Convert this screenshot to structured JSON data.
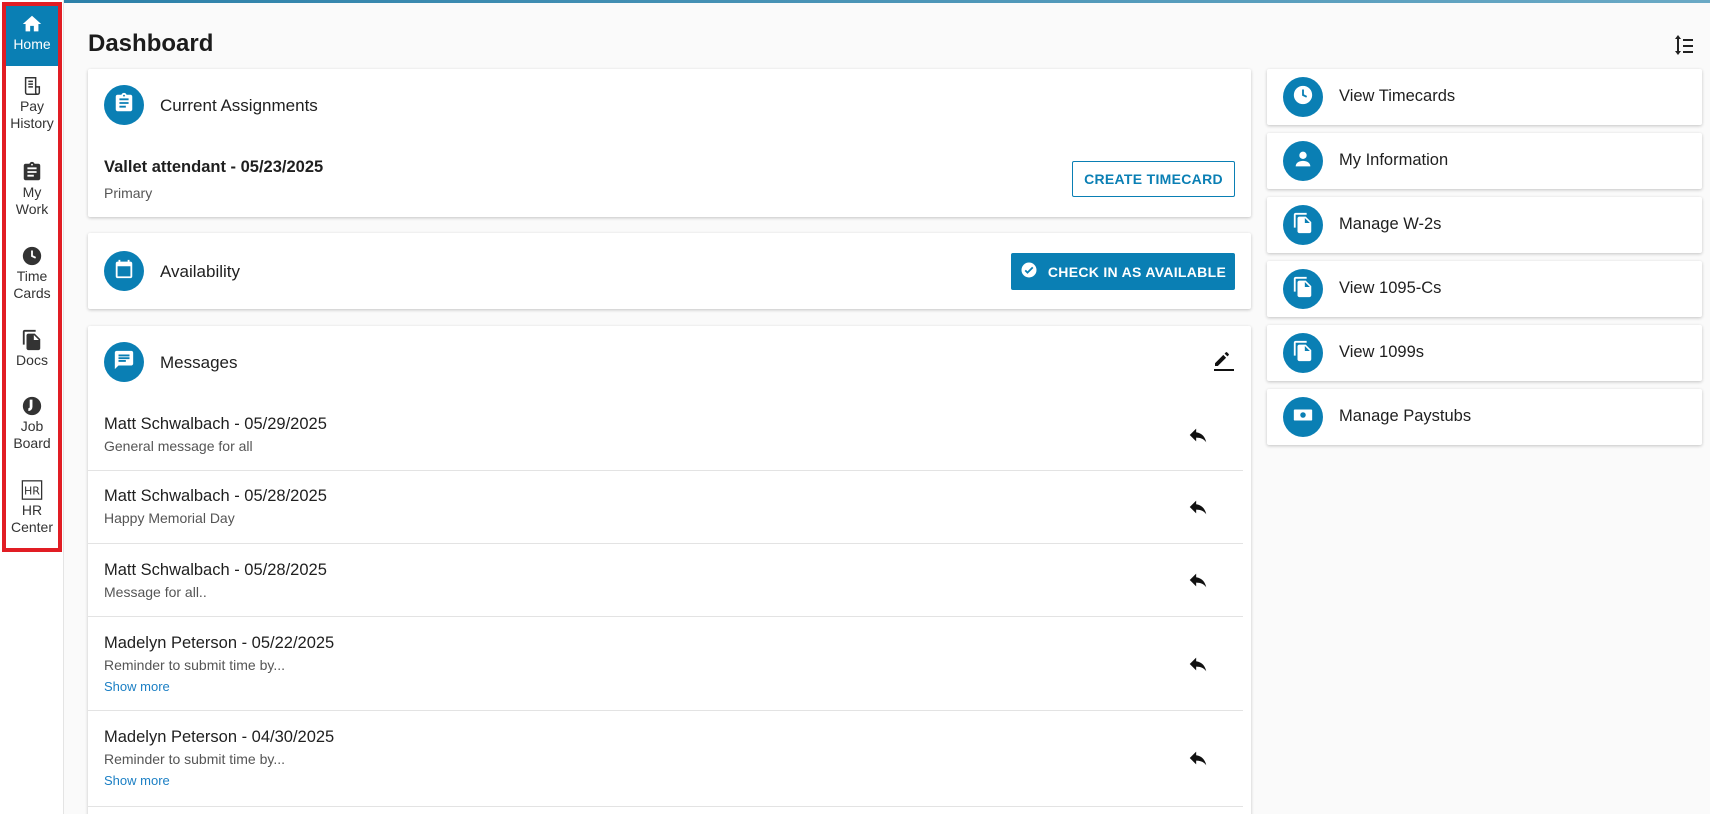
{
  "sidebar": {
    "items": [
      {
        "label_line1": "Home",
        "label_line2": "",
        "icon": "home-icon"
      },
      {
        "label_line1": "Pay",
        "label_line2": "History",
        "icon": "receipt-icon"
      },
      {
        "label_line1": "My",
        "label_line2": "Work",
        "icon": "clipboard-icon"
      },
      {
        "label_line1": "Time",
        "label_line2": "Cards",
        "icon": "clock-icon"
      },
      {
        "label_line1": "Docs",
        "label_line2": "",
        "icon": "documents-icon"
      },
      {
        "label_line1": "Job",
        "label_line2": "Board",
        "icon": "job-board-icon"
      },
      {
        "label_line1": "HR",
        "label_line2": "Center",
        "icon": "hr-icon"
      }
    ],
    "active_index": 0
  },
  "header": {
    "title": "Dashboard"
  },
  "assignments": {
    "title": "Current Assignments",
    "item_title": "Vallet attendant - 05/23/2025",
    "item_subtitle": "Primary",
    "button": "CREATE TIMECARD"
  },
  "availability": {
    "title": "Availability",
    "button": "CHECK IN AS AVAILABLE"
  },
  "messages": {
    "title": "Messages",
    "items": [
      {
        "header": "Matt Schwalbach - 05/29/2025",
        "body": "General message for all",
        "more": ""
      },
      {
        "header": "Matt Schwalbach - 05/28/2025",
        "body": "Happy Memorial Day",
        "more": ""
      },
      {
        "header": "Matt Schwalbach - 05/28/2025",
        "body": "Message for all..",
        "more": ""
      },
      {
        "header": "Madelyn Peterson - 05/22/2025",
        "body": "Reminder to submit time by...",
        "more": "Show more"
      },
      {
        "header": "Madelyn Peterson - 04/30/2025",
        "body": "Reminder to submit time by...",
        "more": "Show more"
      }
    ]
  },
  "quick_links": [
    {
      "label": "View Timecards",
      "icon": "clock-icon"
    },
    {
      "label": "My Information",
      "icon": "person-icon"
    },
    {
      "label": "Manage W-2s",
      "icon": "documents-icon"
    },
    {
      "label": "View 1095-Cs",
      "icon": "documents-icon"
    },
    {
      "label": "View 1099s",
      "icon": "documents-icon"
    },
    {
      "label": "Manage Paystubs",
      "icon": "money-icon"
    }
  ],
  "colors": {
    "accent": "#0a7fb4",
    "highlight_border": "#e11d24"
  }
}
